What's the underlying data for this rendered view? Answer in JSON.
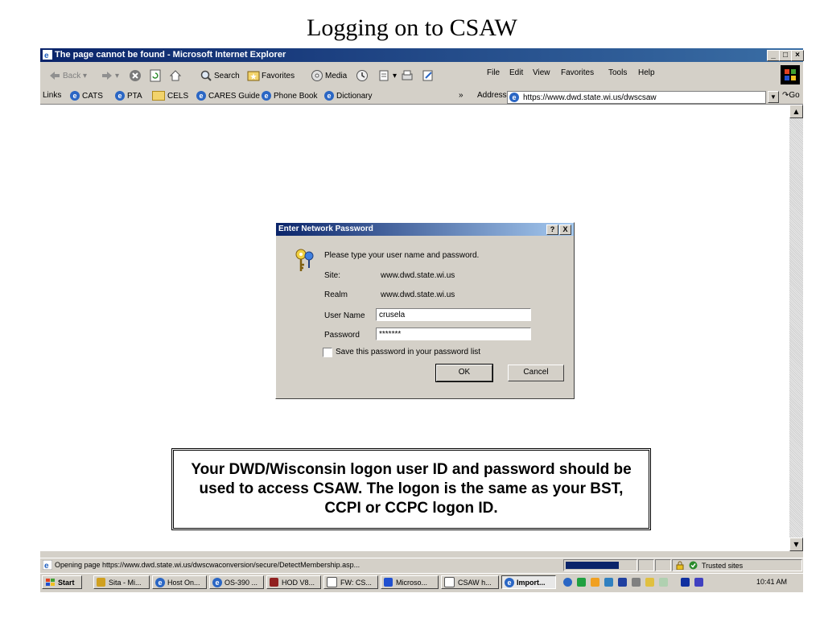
{
  "slide_title": "Logging on to CSAW",
  "window": {
    "title": "The page cannot be found - Microsoft Internet Explorer"
  },
  "toolbar": {
    "back_label": "Back",
    "search_label": "Search",
    "favorites_label": "Favorites",
    "media_label": "Media"
  },
  "menu": {
    "file": "File",
    "edit": "Edit",
    "view": "View",
    "favorites": "Favorites",
    "tools": "Tools",
    "help": "Help"
  },
  "links": {
    "label": "Links",
    "items": [
      "CATS",
      "PTA",
      "CELS",
      "CARES Guide",
      "Phone Book",
      "Dictionary"
    ],
    "overflow": "»"
  },
  "address": {
    "label": "Address",
    "url": "https://www.dwd.state.wi.us/dwscsaw",
    "go_label": "Go"
  },
  "dialog": {
    "title": "Enter Network Password",
    "help": "?",
    "close": "X",
    "prompt": "Please type your user name and password.",
    "site_label": "Site:",
    "site_value": "www.dwd.state.wi.us",
    "realm_label": "Realm",
    "realm_value": "www.dwd.state.wi.us",
    "user_label": "User Name",
    "user_value": "crusela",
    "password_label": "Password",
    "password_value": "*******",
    "save_label": "Save this password in your password list",
    "save_checked": false,
    "ok_label": "OK",
    "cancel_label": "Cancel"
  },
  "callout": "Your DWD/Wisconsin logon user ID and password should be used to access CSAW. The logon is the same as your BST, CCPI or CCPC logon ID.",
  "status": {
    "text": "Opening page https://www.dwd.state.wi.us/dwscwaconversion/secure/DetectMembership.asp...",
    "zone": "Trusted sites"
  },
  "taskbar": {
    "start_label": "Start",
    "tasks": [
      "Sita - Mi...",
      "Host On...",
      "OS-390 ...",
      "HOD V8...",
      "FW: CS...",
      "Microso...",
      "CSAW h...",
      "Import..."
    ],
    "clock": "10:41 AM"
  }
}
